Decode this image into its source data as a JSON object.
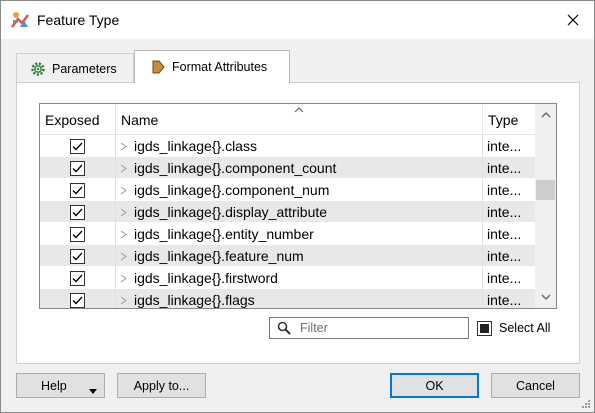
{
  "window": {
    "title": "Feature Type",
    "title_icon": "fme-workbench-icon",
    "close_icon": "close-icon"
  },
  "tabs": [
    {
      "label": "Parameters",
      "icon": "gear-icon",
      "active": false
    },
    {
      "label": "Format Attributes",
      "icon": "arrow-tag-icon",
      "active": true
    }
  ],
  "table": {
    "headers": {
      "exposed": "Exposed",
      "name": "Name",
      "type": "Type"
    },
    "rows": [
      {
        "exposed": true,
        "name": "igds_linkage{}.class",
        "type": "inte..."
      },
      {
        "exposed": true,
        "name": "igds_linkage{}.component_count",
        "type": "inte..."
      },
      {
        "exposed": true,
        "name": "igds_linkage{}.component_num",
        "type": "inte..."
      },
      {
        "exposed": true,
        "name": "igds_linkage{}.display_attribute",
        "type": "inte..."
      },
      {
        "exposed": true,
        "name": "igds_linkage{}.entity_number",
        "type": "inte..."
      },
      {
        "exposed": true,
        "name": "igds_linkage{}.feature_num",
        "type": "inte..."
      },
      {
        "exposed": true,
        "name": "igds_linkage{}.firstword",
        "type": "inte..."
      },
      {
        "exposed": true,
        "name": "igds_linkage{}.flags",
        "type": "inte..."
      }
    ]
  },
  "filter": {
    "placeholder": "Filter",
    "value": ""
  },
  "select_all": {
    "label": "Select All",
    "state": "partial"
  },
  "buttons": {
    "help": "Help",
    "apply": "Apply to...",
    "ok": "OK",
    "cancel": "Cancel"
  }
}
